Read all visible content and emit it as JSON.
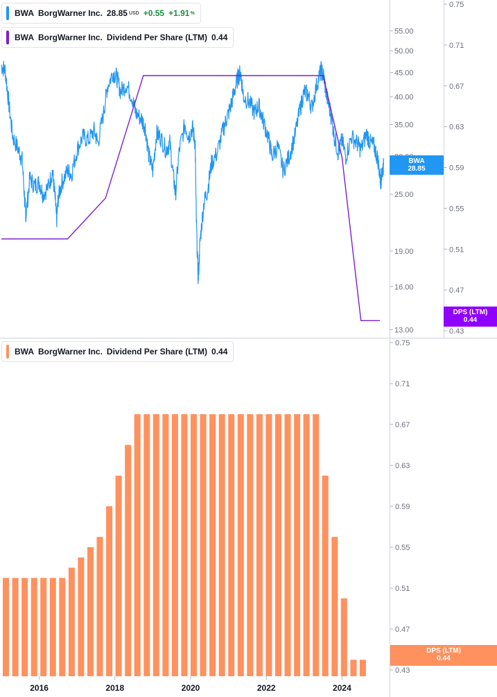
{
  "colors": {
    "price": "#2196f3",
    "dps_line": "#7b1fd1",
    "bars": "#ff915e",
    "grid": "#e0e3eb",
    "axis_text": "#6b6f7b",
    "positive": "#1a8f3c"
  },
  "legend_top_1": {
    "symbol": "BWA",
    "name": "BorgWarner Inc.",
    "price": "28.85",
    "currency": "USD",
    "change": "+0.55",
    "change_pct": "+1.91",
    "pct_sign": "%"
  },
  "legend_top_2": {
    "symbol": "BWA",
    "name": "BorgWarner Inc.",
    "metric": "Dividend Per Share (LTM)",
    "value": "0.44"
  },
  "legend_bottom": {
    "symbol": "BWA",
    "name": "BorgWarner Inc.",
    "metric": "Dividend Per Share (LTM)",
    "value": "0.44"
  },
  "tags": {
    "price_label": "BWA",
    "price_value": "28.85",
    "dps_label": "DPS (LTM)",
    "dps_value": "0.44"
  },
  "chart_data": [
    {
      "type": "line",
      "title": "",
      "price_scale": "log",
      "price_axis_ticks": [
        "55.00",
        "50.00",
        "45.00",
        "40.00",
        "35.00",
        "30.00",
        "25.00",
        "19.00",
        "16.00",
        "13.00"
      ],
      "dps_axis_ticks": [
        "0.75",
        "0.71",
        "0.67",
        "0.63",
        "0.59",
        "0.55",
        "0.51",
        "0.47",
        "0.43"
      ],
      "price_series_name": "BWA",
      "price_series": [
        [
          2015.0,
          46.5
        ],
        [
          2015.1,
          45.5
        ],
        [
          2015.2,
          38.5
        ],
        [
          2015.3,
          33.0
        ],
        [
          2015.45,
          31.0
        ],
        [
          2015.55,
          29.5
        ],
        [
          2015.62,
          24.0
        ],
        [
          2015.65,
          22.5
        ],
        [
          2015.75,
          27.0
        ],
        [
          2015.88,
          26.0
        ],
        [
          2016.0,
          26.5
        ],
        [
          2016.1,
          25.0
        ],
        [
          2016.25,
          26.0
        ],
        [
          2016.35,
          28.0
        ],
        [
          2016.42,
          24.5
        ],
        [
          2016.46,
          22.0
        ],
        [
          2016.5,
          24.5
        ],
        [
          2016.6,
          26.5
        ],
        [
          2016.75,
          28.0
        ],
        [
          2016.85,
          27.5
        ],
        [
          2017.0,
          31.0
        ],
        [
          2017.15,
          33.0
        ],
        [
          2017.3,
          32.5
        ],
        [
          2017.45,
          34.0
        ],
        [
          2017.55,
          32.0
        ],
        [
          2017.7,
          37.0
        ],
        [
          2017.8,
          42.0
        ],
        [
          2017.95,
          45.0
        ],
        [
          2018.05,
          44.0
        ],
        [
          2018.15,
          41.0
        ],
        [
          2018.3,
          42.5
        ],
        [
          2018.45,
          40.0
        ],
        [
          2018.55,
          37.0
        ],
        [
          2018.7,
          36.0
        ],
        [
          2018.8,
          34.5
        ],
        [
          2018.9,
          30.0
        ],
        [
          2019.0,
          28.0
        ],
        [
          2019.1,
          33.5
        ],
        [
          2019.2,
          33.0
        ],
        [
          2019.35,
          31.0
        ],
        [
          2019.45,
          32.0
        ],
        [
          2019.55,
          27.0
        ],
        [
          2019.6,
          25.0
        ],
        [
          2019.7,
          31.0
        ],
        [
          2019.85,
          35.0
        ],
        [
          2019.95,
          33.0
        ],
        [
          2020.05,
          34.5
        ],
        [
          2020.12,
          32.0
        ],
        [
          2020.15,
          22.0
        ],
        [
          2020.2,
          16.5
        ],
        [
          2020.25,
          20.0
        ],
        [
          2020.35,
          24.0
        ],
        [
          2020.45,
          25.5
        ],
        [
          2020.55,
          29.0
        ],
        [
          2020.7,
          30.5
        ],
        [
          2020.85,
          34.0
        ],
        [
          2020.95,
          36.0
        ],
        [
          2021.05,
          38.0
        ],
        [
          2021.15,
          41.0
        ],
        [
          2021.25,
          44.0
        ],
        [
          2021.32,
          45.0
        ],
        [
          2021.4,
          40.0
        ],
        [
          2021.55,
          39.0
        ],
        [
          2021.7,
          37.0
        ],
        [
          2021.8,
          38.5
        ],
        [
          2021.9,
          36.0
        ],
        [
          2022.05,
          33.0
        ],
        [
          2022.15,
          30.0
        ],
        [
          2022.3,
          31.5
        ],
        [
          2022.45,
          28.0
        ],
        [
          2022.6,
          30.0
        ],
        [
          2022.75,
          33.0
        ],
        [
          2022.9,
          38.0
        ],
        [
          2023.0,
          41.0
        ],
        [
          2023.1,
          40.5
        ],
        [
          2023.2,
          38.0
        ],
        [
          2023.35,
          43.0
        ],
        [
          2023.45,
          45.5
        ],
        [
          2023.52,
          44.0
        ],
        [
          2023.6,
          40.0
        ],
        [
          2023.7,
          37.0
        ],
        [
          2023.8,
          33.0
        ],
        [
          2023.9,
          30.5
        ],
        [
          2024.0,
          32.5
        ],
        [
          2024.1,
          30.0
        ],
        [
          2024.25,
          33.0
        ],
        [
          2024.4,
          32.0
        ],
        [
          2024.5,
          31.0
        ],
        [
          2024.65,
          33.5
        ],
        [
          2024.75,
          32.0
        ],
        [
          2024.85,
          31.5
        ],
        [
          2024.95,
          29.5
        ],
        [
          2025.02,
          26.5
        ],
        [
          2025.05,
          27.5
        ],
        [
          2025.1,
          28.85
        ]
      ],
      "dps_series_name": "DPS (LTM)",
      "dps_series": [
        [
          2015.0,
          0.52
        ],
        [
          2016.75,
          0.52
        ],
        [
          2017.75,
          0.56
        ],
        [
          2018.75,
          0.68
        ],
        [
          2023.5,
          0.68
        ],
        [
          2024.0,
          0.6
        ],
        [
          2024.5,
          0.44
        ],
        [
          2025.0,
          0.44
        ]
      ]
    },
    {
      "type": "bar",
      "title": "",
      "y_axis_ticks": [
        "0.75",
        "0.71",
        "0.67",
        "0.63",
        "0.59",
        "0.55",
        "0.51",
        "0.47",
        "0.43"
      ],
      "ylim": [
        0.43,
        0.75
      ],
      "x_axis_ticks": [
        "2016",
        "2018",
        "2020",
        "2022",
        "2024"
      ],
      "series_name": "DPS (LTM)",
      "categories": [
        "2015Q2",
        "2015Q3",
        "2015Q4",
        "2016Q1",
        "2016Q2",
        "2016Q3",
        "2016Q4",
        "2017Q1",
        "2017Q2",
        "2017Q3",
        "2017Q4",
        "2018Q1",
        "2018Q2",
        "2018Q3",
        "2018Q4",
        "2019Q1",
        "2019Q2",
        "2019Q3",
        "2019Q4",
        "2020Q1",
        "2020Q2",
        "2020Q3",
        "2020Q4",
        "2021Q1",
        "2021Q2",
        "2021Q3",
        "2021Q4",
        "2022Q1",
        "2022Q2",
        "2022Q3",
        "2022Q4",
        "2023Q1",
        "2023Q2",
        "2023Q3",
        "2023Q4",
        "2024Q1",
        "2024Q2",
        "2024Q3",
        "2024Q4"
      ],
      "values": [
        0.52,
        0.52,
        0.52,
        0.52,
        0.52,
        0.52,
        0.52,
        0.53,
        0.54,
        0.55,
        0.56,
        0.59,
        0.62,
        0.65,
        0.68,
        0.68,
        0.68,
        0.68,
        0.68,
        0.68,
        0.68,
        0.68,
        0.68,
        0.68,
        0.68,
        0.68,
        0.68,
        0.68,
        0.68,
        0.68,
        0.68,
        0.68,
        0.68,
        0.68,
        0.62,
        0.56,
        0.5,
        0.44,
        0.44
      ]
    }
  ]
}
